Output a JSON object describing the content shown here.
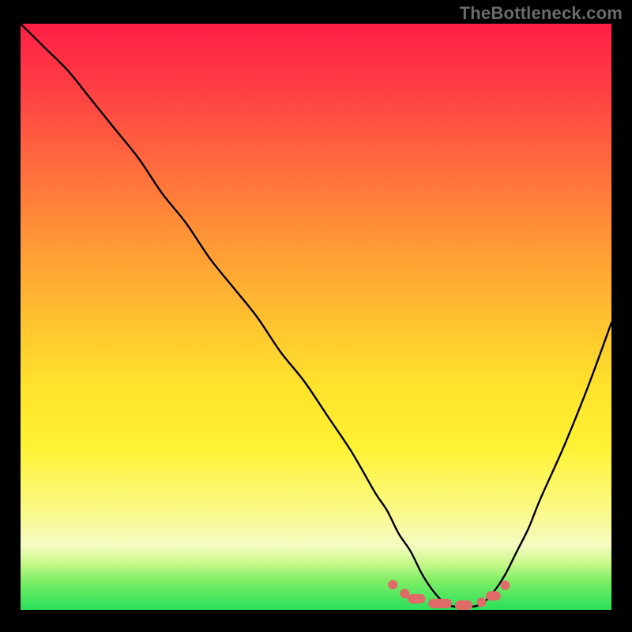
{
  "watermark": "TheBottleneck.com",
  "chart_data": {
    "type": "line",
    "title": "",
    "xlabel": "",
    "ylabel": "",
    "xlim": [
      0,
      100
    ],
    "ylim": [
      0,
      100
    ],
    "grid": false,
    "description": "Bottleneck curve over a vertical red-to-green gradient. Curve descends smoothly from top-left to a near-zero minimum around x≈72–78 then rises toward the right edge.",
    "x": [
      0,
      4,
      8,
      12,
      16,
      20,
      24,
      28,
      32,
      36,
      40,
      44,
      48,
      52,
      56,
      60,
      62,
      64,
      66,
      68,
      70,
      72,
      74,
      76,
      78,
      80,
      82,
      84,
      86,
      88,
      92,
      96,
      100
    ],
    "y": [
      100,
      96,
      92,
      87,
      82,
      77,
      71,
      66,
      60,
      55,
      50,
      44,
      39,
      33,
      27,
      20,
      17,
      13,
      10,
      6,
      3,
      1,
      0.5,
      0.5,
      1,
      3,
      6,
      10,
      14,
      19,
      28,
      38,
      49
    ],
    "gradient_stops": [
      {
        "pos": 0,
        "color": "#ff1f46"
      },
      {
        "pos": 10,
        "color": "#ff3b44"
      },
      {
        "pos": 24,
        "color": "#ff6a3e"
      },
      {
        "pos": 38,
        "color": "#ff9a35"
      },
      {
        "pos": 52,
        "color": "#ffc62f"
      },
      {
        "pos": 62,
        "color": "#ffe32c"
      },
      {
        "pos": 72,
        "color": "#fff232"
      },
      {
        "pos": 82,
        "color": "#fbf97e"
      },
      {
        "pos": 89,
        "color": "#f5fbc2"
      },
      {
        "pos": 92,
        "color": "#c9f98a"
      },
      {
        "pos": 95,
        "color": "#7eee66"
      },
      {
        "pos": 100,
        "color": "#29e05a"
      }
    ],
    "markers": [
      {
        "x": 63,
        "y": 4.3,
        "kind": "dot"
      },
      {
        "x": 65,
        "y": 2.8,
        "kind": "dot"
      },
      {
        "x": 67,
        "y": 1.9,
        "kind": "pill",
        "w": 3
      },
      {
        "x": 71,
        "y": 1.1,
        "kind": "pill",
        "w": 4
      },
      {
        "x": 75,
        "y": 0.8,
        "kind": "pill",
        "w": 3
      },
      {
        "x": 78,
        "y": 1.3,
        "kind": "dot"
      },
      {
        "x": 80,
        "y": 2.4,
        "kind": "pill",
        "w": 2.5
      },
      {
        "x": 82,
        "y": 4.2,
        "kind": "dot"
      }
    ],
    "marker_color": "#e06a67"
  }
}
